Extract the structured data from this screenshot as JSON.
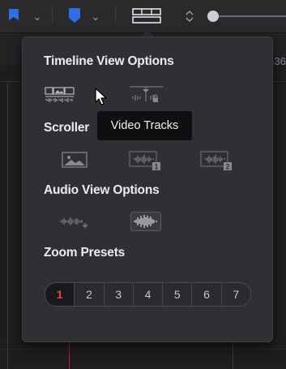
{
  "ruler": {
    "number": "36"
  },
  "popup": {
    "sections": {
      "timeline_view": "Timeline View Options",
      "scroller": "Scroller",
      "audio_view": "Audio View Options",
      "zoom_presets": "Zoom Presets"
    },
    "tooltip": "Video Tracks",
    "zoom": [
      "1",
      "2",
      "3",
      "4",
      "5",
      "6",
      "7"
    ],
    "zoom_active_index": 0
  },
  "colors": {
    "accent_blue": "#2f6fe6",
    "active_red": "#e5484d",
    "playhead": "#b5232b"
  },
  "icons": {
    "toolbar": [
      "flag-marker-icon",
      "chevron-down-icon",
      "blue-marker-icon",
      "chevron-down-icon",
      "timeline-view-icon",
      "zoom-stepper-icon",
      "zoom-slider"
    ],
    "timeline_view": [
      "video-tracks-icon",
      "audio-waveform-lock-icon"
    ],
    "scroller": [
      "scroller-image-icon",
      "scroller-audio-1-icon",
      "scroller-audio-2-icon"
    ],
    "audio_view": [
      "audio-waveform-icon",
      "audio-waveform-full-icon"
    ]
  }
}
